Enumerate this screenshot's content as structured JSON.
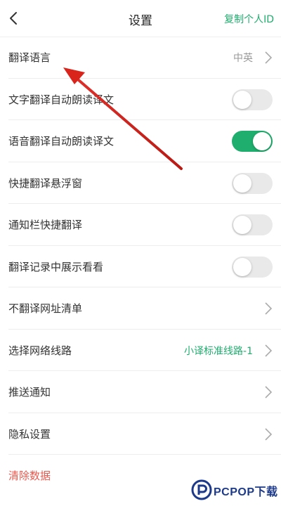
{
  "header": {
    "title": "设置",
    "action": "复制个人ID"
  },
  "settings": [
    {
      "label": "翻译语言",
      "value": "中英",
      "control": "chevron"
    },
    {
      "label": "文字翻译自动朗读译文",
      "control": "toggle",
      "on": false
    },
    {
      "label": "语音翻译自动朗读译文",
      "control": "toggle",
      "on": true
    },
    {
      "label": "快捷翻译悬浮窗",
      "control": "toggle",
      "on": false
    },
    {
      "label": "通知栏快捷翻译",
      "control": "toggle",
      "on": false
    },
    {
      "label": "翻译记录中展示看看",
      "control": "toggle",
      "on": false
    },
    {
      "label": "不翻译网址清单",
      "control": "chevron"
    },
    {
      "label": "选择网络线路",
      "value": "小译标准线路-1",
      "control": "chevron"
    },
    {
      "label": "推送通知",
      "control": "chevron"
    },
    {
      "label": "隐私设置",
      "control": "chevron"
    }
  ],
  "clear_data": {
    "label": "清除数据"
  },
  "watermark": {
    "brand": "PCPOP下载"
  },
  "colors": {
    "accent": "#1fae6d",
    "danger": "#e85a4f",
    "arrow": "#d9241c",
    "watermark": "#1d3a8a"
  },
  "icons": {
    "back": "chevron-left-icon",
    "row_arrow": "chevron-right-icon"
  }
}
